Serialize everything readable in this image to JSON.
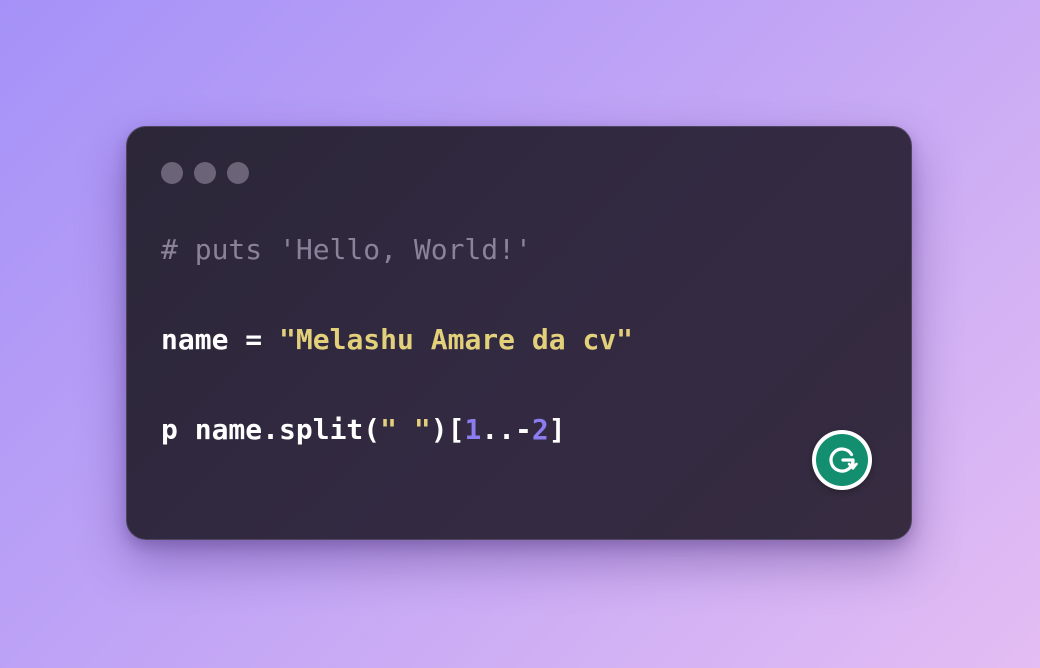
{
  "window": {
    "controls": [
      "close",
      "minimize",
      "maximize"
    ]
  },
  "code": {
    "line1": {
      "comment": "# puts 'Hello, World!'"
    },
    "line2": {
      "var": "name",
      "op": " = ",
      "string": "\"Melashu Amare da cv\""
    },
    "line3": {
      "prefix": "p name.split(",
      "string": "\" \"",
      "open": ")[",
      "start": "1",
      "range": "..-",
      "end": "2",
      "close": "]"
    }
  },
  "colors": {
    "background_start": "#a592f8",
    "background_end": "#e3bdf3",
    "editor_background": "#2f283d",
    "comment": "#8a8299",
    "string": "#e3d07a",
    "number": "#8b7cf0",
    "plain": "#ffffff",
    "grammarly_green": "#138f70"
  },
  "icons": {
    "grammarly": "grammarly-g-icon"
  }
}
